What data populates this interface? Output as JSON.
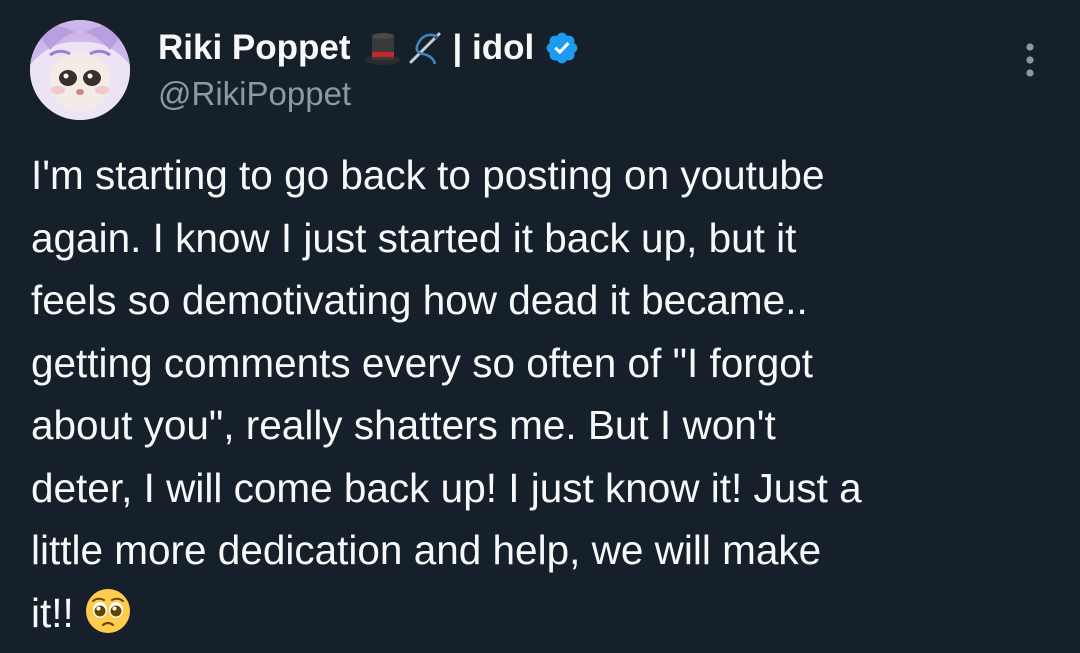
{
  "author": {
    "display_name": "Riki Poppet",
    "name_emojis": [
      "top-hat-icon",
      "needle-thread-icon"
    ],
    "name_suffix": "| idol",
    "handle": "@RikiPoppet",
    "verified": true,
    "verified_color": "#1d9bf0"
  },
  "tweet": {
    "lines": [
      "I'm starting to go back to posting on youtube",
      "again. I know I just started it back up, but it",
      "feels so demotivating how dead it became..",
      "getting comments every so often of \"I forgot",
      "about you\", really shatters me. But I won't",
      "deter, I will come back up! I just know it! Just a",
      "little more dedication and help, we will make",
      "it!!"
    ],
    "trailing_emoji": "pleading-face-icon"
  },
  "menu": {
    "icon": "more-vertical-icon"
  },
  "colors": {
    "background": "#15202b",
    "text_primary": "#f7f9f9",
    "text_secondary": "#8b98a5"
  }
}
